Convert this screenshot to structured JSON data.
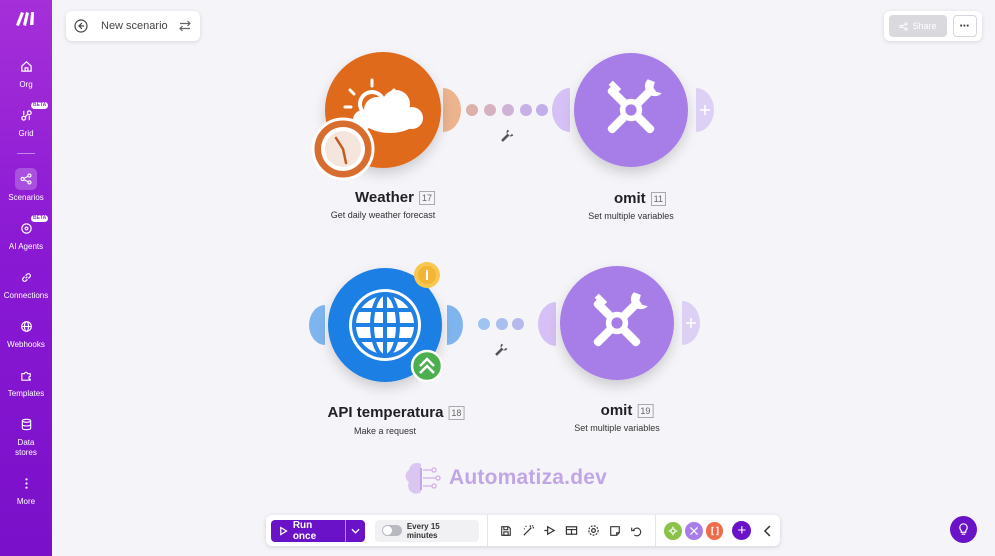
{
  "sidebar": {
    "items": [
      {
        "label": "Org",
        "icon": "home-icon"
      },
      {
        "label": "Grid",
        "icon": "grid-icon",
        "badge": "BETA"
      },
      {
        "label": "Scenarios",
        "icon": "share-nodes-icon",
        "active": true
      },
      {
        "label": "AI Agents",
        "icon": "ai-agents-icon",
        "badge": "BETA"
      },
      {
        "label": "Connections",
        "icon": "link-icon"
      },
      {
        "label": "Webhooks",
        "icon": "globe-icon"
      },
      {
        "label": "Templates",
        "icon": "puzzle-icon"
      },
      {
        "label": "Data stores",
        "icon": "database-icon"
      },
      {
        "label": "More",
        "icon": "more-vertical-icon"
      }
    ]
  },
  "header": {
    "scenario_name": "New scenario",
    "share_label": "Share",
    "more_label": "⋯"
  },
  "modules": [
    {
      "title": "Weather",
      "id": "17",
      "subtitle": "Get daily weather forecast",
      "color": "#e06a1e",
      "icon": "weather-icon"
    },
    {
      "title": "omit",
      "id": "11",
      "subtitle": "Set multiple variables",
      "color": "#a77de8",
      "icon": "tools-icon"
    },
    {
      "title": "API temperatura",
      "id": "18",
      "subtitle": "Make a request",
      "color": "#1f7fe3",
      "icon": "globe-icon"
    },
    {
      "title": "omit",
      "id": "19",
      "subtitle": "Set multiple variables",
      "color": "#a77de8",
      "icon": "tools-icon"
    }
  ],
  "watermark": "Automatiza.dev",
  "toolbar": {
    "run_label": "Run once",
    "schedule_label": "Every 15 minutes"
  },
  "colors": {
    "brand": "#6a12c7",
    "sidebar_top": "#a52fd8",
    "weather": "#e06a1e",
    "http": "#1f7fe3",
    "tools": "#a77de8"
  }
}
